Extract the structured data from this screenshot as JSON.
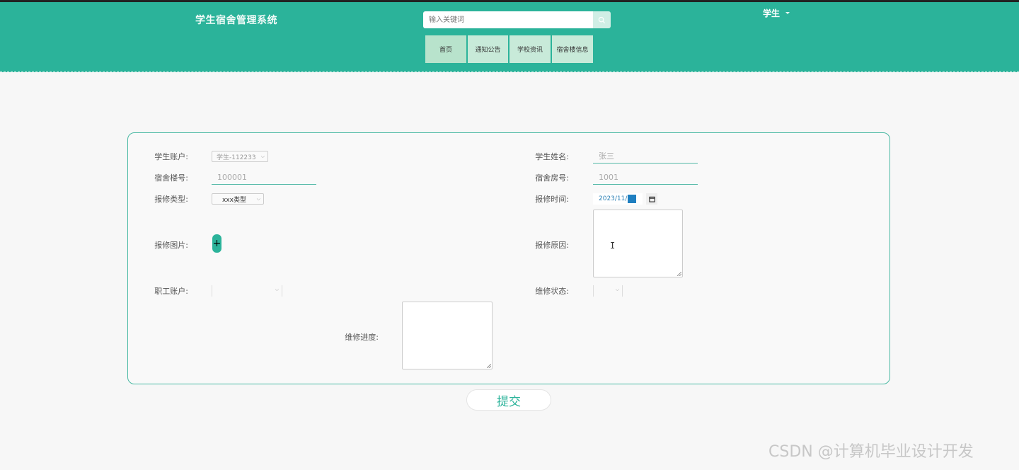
{
  "header": {
    "title": "学生宿舍管理系统",
    "search": {
      "placeholder": "输入关键词"
    },
    "user": "学生",
    "nav": [
      "首页",
      "通知公告",
      "学校资讯",
      "宿舍楼信息"
    ]
  },
  "form": {
    "student_account": {
      "label": "学生账户:",
      "value": "学生-112233"
    },
    "student_name": {
      "label": "学生姓名:",
      "value": "张三"
    },
    "building_no": {
      "label": "宿舍楼号:",
      "value": "100001"
    },
    "room_no": {
      "label": "宿舍房号:",
      "value": "1001"
    },
    "repair_type": {
      "label": "报修类型:",
      "value": "xxx类型"
    },
    "repair_time": {
      "label": "报修时间:",
      "value": "2023/11/"
    },
    "repair_image": {
      "label": "报修图片:",
      "button": "+"
    },
    "repair_reason": {
      "label": "报修原因:"
    },
    "staff_account": {
      "label": "职工账户:"
    },
    "repair_status": {
      "label": "维修状态:"
    },
    "repair_progress": {
      "label": "维修进度:"
    }
  },
  "submit_label": "提交",
  "watermark": "CSDN @计算机毕业设计开发",
  "colors": {
    "primary": "#2bb39a",
    "nav_bg": "#c8ead9"
  }
}
